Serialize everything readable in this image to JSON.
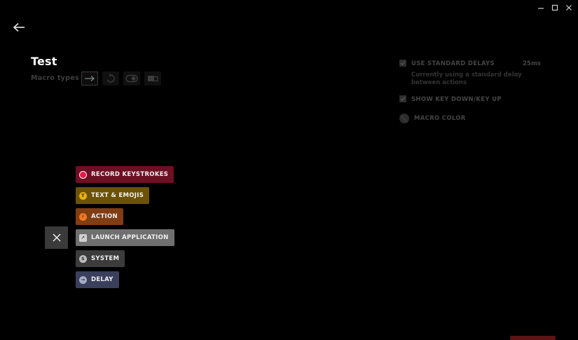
{
  "window": {
    "controls": {
      "minimize_icon": "minimize-icon",
      "maximize_icon": "maximize-icon",
      "close_icon": "close-window-icon"
    }
  },
  "header": {
    "back_icon": "back-arrow-icon",
    "title": "Test",
    "macro_types_label": "Macro types",
    "macro_types": [
      {
        "icon": "arrow-right-icon",
        "selected": true
      },
      {
        "icon": "repeat-icon",
        "selected": false
      },
      {
        "icon": "toggle-icon",
        "selected": false
      },
      {
        "icon": "sequence-icon",
        "selected": false
      }
    ]
  },
  "settings": {
    "use_standard_delays": {
      "label": "USE STANDARD DELAYS",
      "checked": true,
      "value": "25ms",
      "description": "Currently using a standard delay between actions"
    },
    "show_key_down_up": {
      "label": "SHOW KEY DOWN/KEY UP",
      "checked": true
    },
    "macro_color": {
      "label": "MACRO COLOR"
    }
  },
  "add_menu": {
    "close_icon": "close-icon",
    "items": [
      {
        "label": "RECORD KEYSTROKES",
        "icon": "record-icon",
        "icon_text": "",
        "color": "#6e0f24",
        "icon_color": "#e8194a"
      },
      {
        "label": "TEXT & EMOJIS",
        "icon": "text-icon",
        "icon_text": "T",
        "color": "#6b5206",
        "icon_color": "#e8b10f"
      },
      {
        "label": "ACTION",
        "icon": "lightning-icon",
        "icon_text": "⚡",
        "color": "#803d14",
        "icon_color": "#f07a1e"
      },
      {
        "label": "LAUNCH APPLICATION",
        "icon": "launch-icon",
        "icon_text": "↗",
        "color": "#6f6f6f",
        "icon_color": "#d0d0d0"
      },
      {
        "label": "SYSTEM",
        "icon": "system-icon",
        "icon_text": "S",
        "color": "#3c3c3c",
        "icon_color": "#bdbdbd"
      },
      {
        "label": "DELAY",
        "icon": "clock-icon",
        "icon_text": "→",
        "color": "#3a3f5c",
        "icon_color": "#a7adc8"
      }
    ]
  },
  "colors": {
    "background": "#000000",
    "accent_red": "#5e1414"
  }
}
